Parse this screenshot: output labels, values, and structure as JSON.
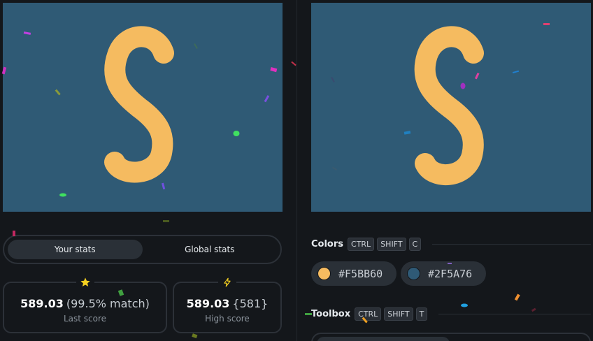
{
  "colors": {
    "shape": "#F5BB60",
    "background": "#2F5A76",
    "page": "#14171b"
  },
  "tabs": [
    {
      "label": "Your stats",
      "active": true
    },
    {
      "label": "Global stats",
      "active": false
    }
  ],
  "stats": {
    "last": {
      "value": "589.03",
      "extra": "(99.5% match)",
      "label": "Last score",
      "icon": "star-icon",
      "icon_color": "#f5d020"
    },
    "high": {
      "value": "589.03",
      "extra": "{581}",
      "label": "High score",
      "icon": "lightning-icon",
      "icon_color": "#f5d020"
    }
  },
  "colors_section": {
    "title": "Colors",
    "shortcut": [
      "CTRL",
      "SHIFT",
      "C"
    ],
    "swatches": [
      {
        "hex": "#F5BB60"
      },
      {
        "hex": "#2F5A76"
      }
    ]
  },
  "toolbox_section": {
    "title": "Toolbox",
    "shortcut": [
      "CTRL",
      "SHIFT",
      "T"
    ]
  }
}
